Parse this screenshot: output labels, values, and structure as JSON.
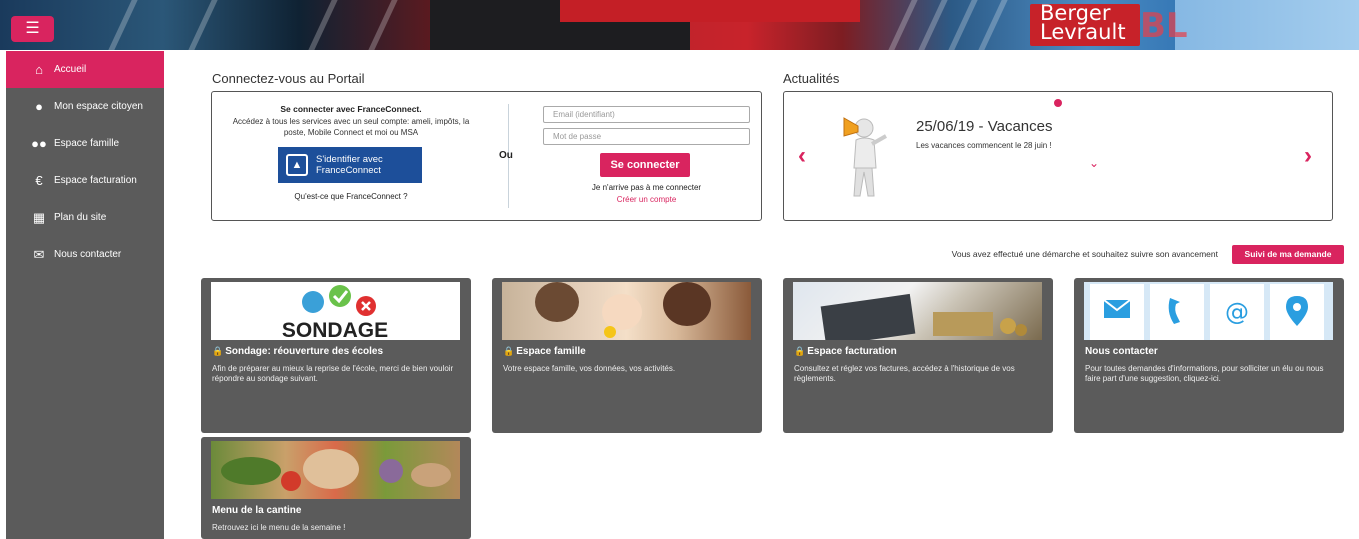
{
  "header": {
    "menu_icon": "hamburger-menu-icon",
    "logo_line1": "Berger",
    "logo_line2": "Levrault",
    "logo_mark": "BL"
  },
  "sidebar": {
    "items": [
      {
        "label": "Accueil",
        "icon": "home-icon",
        "active": true
      },
      {
        "label": "Mon espace citoyen",
        "icon": "person-icon",
        "active": false
      },
      {
        "label": "Espace famille",
        "icon": "family-icon",
        "active": false
      },
      {
        "label": "Espace facturation",
        "icon": "euro-icon",
        "active": false
      },
      {
        "label": "Plan du site",
        "icon": "sitemap-icon",
        "active": false
      },
      {
        "label": "Nous contacter",
        "icon": "envelope-icon",
        "active": false
      }
    ]
  },
  "login": {
    "heading": "Connectez-vous au Portail",
    "fc_title": "Se connecter avec FranceConnect.",
    "fc_desc": "Accédez à tous les services avec un seul compte: ameli, impôts, la poste, Mobile Connect et moi ou MSA",
    "fc_button_line1": "S'identifier avec",
    "fc_button_line2": "FranceConnect",
    "fc_what": "Qu'est-ce que FranceConnect ?",
    "or_label": "Ou",
    "email_placeholder": "Email (identifiant)",
    "password_placeholder": "Mot de passe",
    "connect_button": "Se connecter",
    "forgot": "Je n'arrive pas à me connecter",
    "create": "Créer un compte"
  },
  "news": {
    "heading": "Actualités",
    "title": "25/06/19 - Vacances",
    "text": "Les vacances commencent le 28 juin !",
    "prev": "‹",
    "next": "›",
    "expand": "⌄"
  },
  "suivi": {
    "text": "Vous avez effectué une démarche et souhaitez suivre son avancement",
    "button": "Suivi de ma demande"
  },
  "cards": [
    {
      "title": "Sondage: réouverture des écoles",
      "locked": true,
      "desc": "Afin de préparer au mieux la reprise de l'école, merci de bien vouloir répondre au sondage suivant.",
      "image_text": "SONDAGE"
    },
    {
      "title": "Espace famille",
      "locked": true,
      "desc": "Votre espace famille, vos données, vos activités."
    },
    {
      "title": "Espace facturation",
      "locked": true,
      "desc": "Consultez et réglez vos factures, accédez à l'historique de vos règlements."
    },
    {
      "title": "Nous contacter",
      "locked": false,
      "desc": "Pour toutes demandes d'informations, pour solliciter un élu ou nous faire part d'une suggestion, cliquez-ici."
    },
    {
      "title": "Menu de la cantine",
      "locked": false,
      "desc": "Retrouvez ici le menu de la semaine !"
    }
  ],
  "colors": {
    "accent": "#d9245f",
    "sidebar": "#5b5b5b",
    "franceconnect": "#1d4f9a"
  }
}
